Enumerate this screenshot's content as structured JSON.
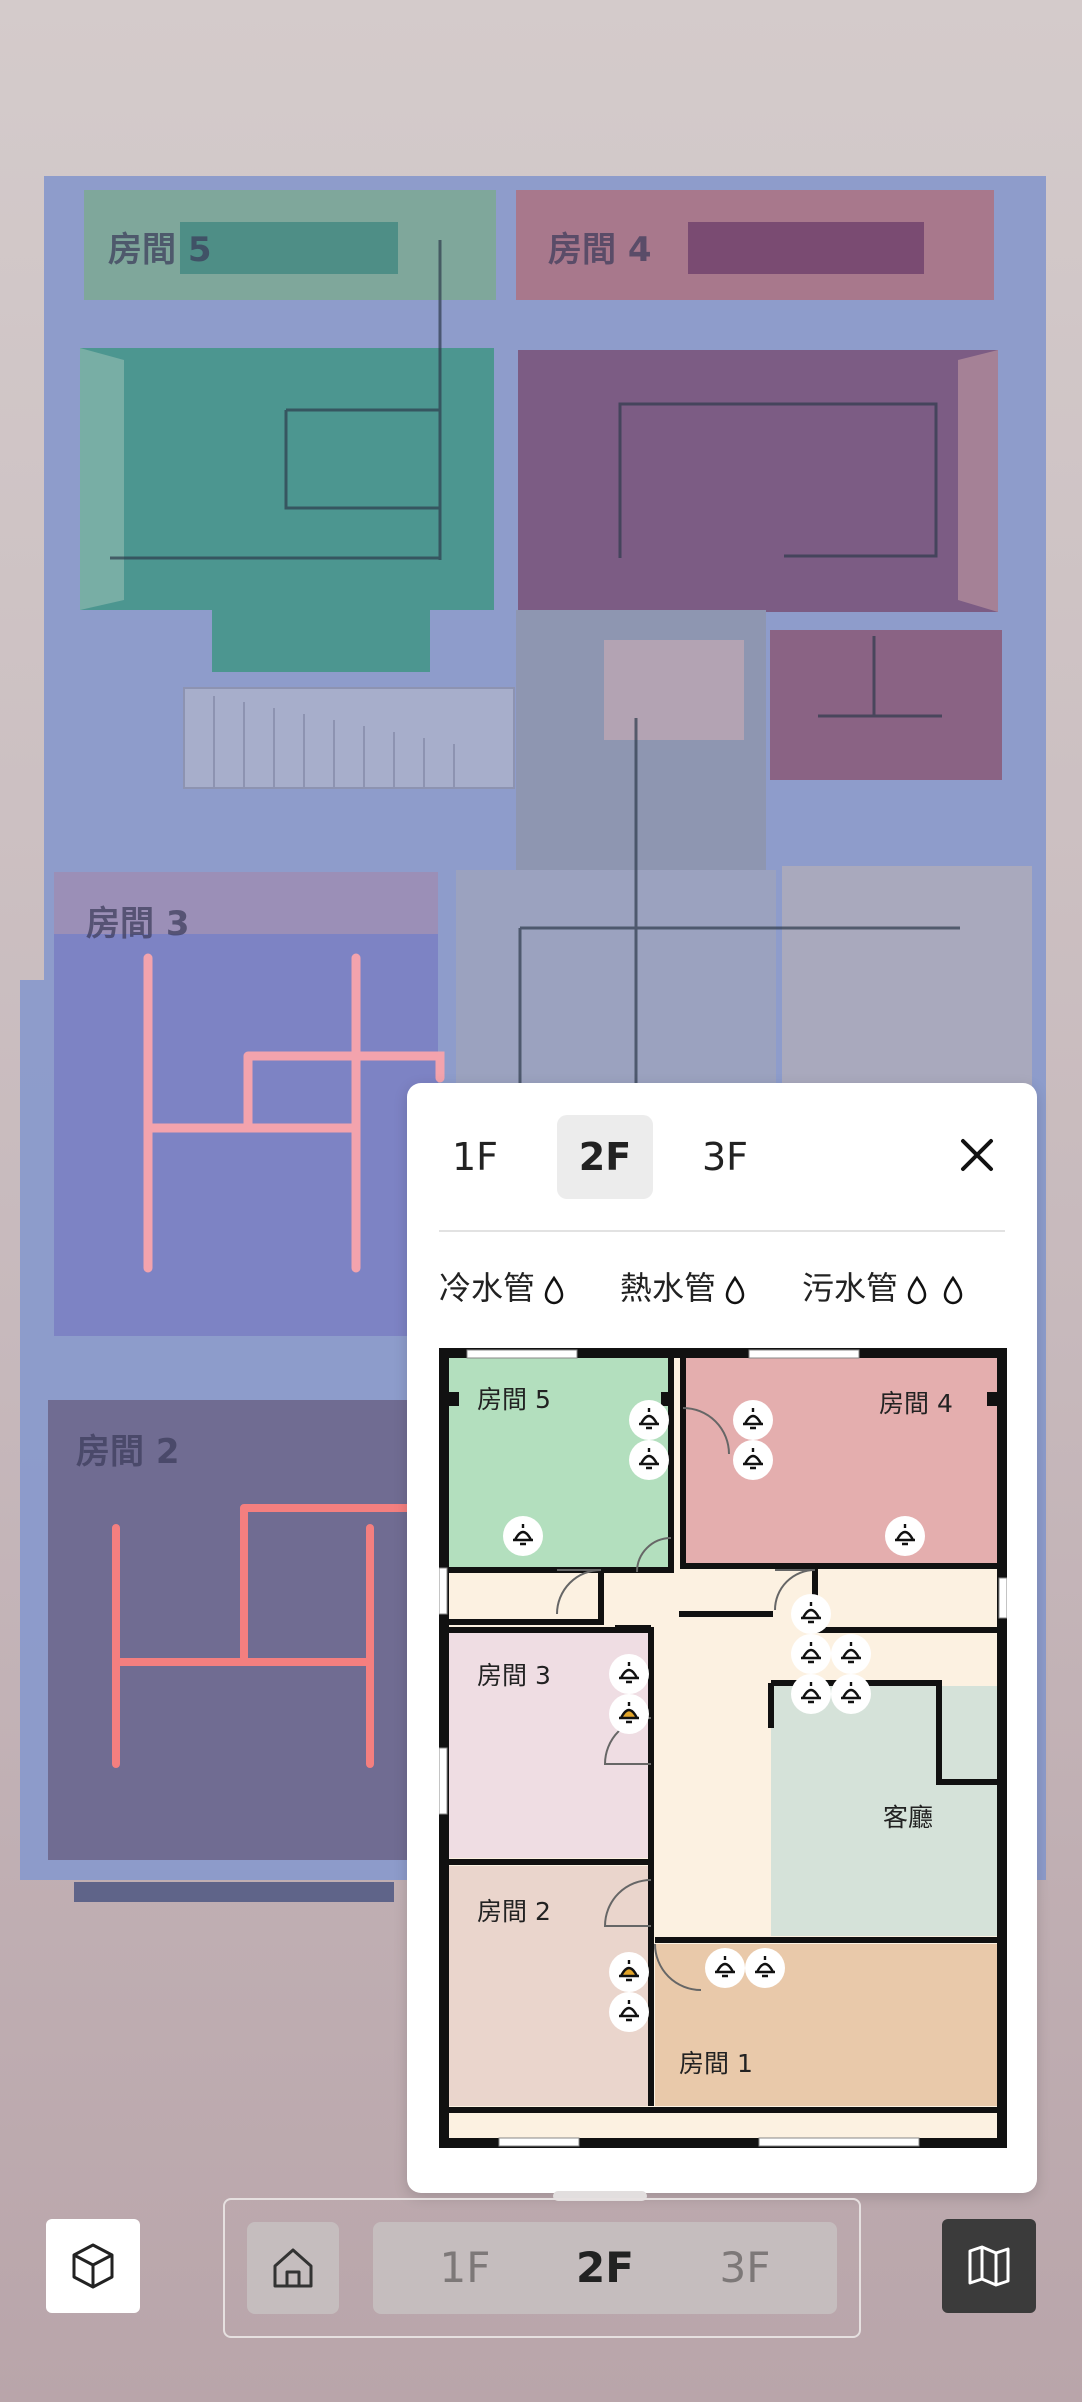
{
  "model_view": {
    "room_labels": [
      "房間 5",
      "房間 4",
      "房間 3",
      "房間 2"
    ]
  },
  "floor_panel": {
    "floors": [
      "1F",
      "2F",
      "3F"
    ],
    "selected_floor": "2F",
    "close_icon": "close-icon",
    "legend": [
      {
        "label": "冷水管",
        "icon": "water-drop-icon"
      },
      {
        "label": "熱水管",
        "icon": "water-drop-icon"
      },
      {
        "label": "污水管",
        "icon": "water-drop-icon"
      }
    ],
    "plan_rooms": [
      "房間 5",
      "房間 4",
      "房間 3",
      "客廳",
      "房間 2",
      "房間 1"
    ],
    "colors": {
      "room5": "#b3dfbe",
      "room4": "#e4aeae",
      "room3": "#efdde3",
      "living": "#d5e2d9",
      "room2": "#ead5cc",
      "room1": "#e9c9aa",
      "hall": "#fcf1e1",
      "lamp_active": "#e2a52a"
    }
  },
  "bottom_bar": {
    "view_3d_icon": "cube-icon",
    "home_icon": "home-icon",
    "floors": [
      "1F",
      "2F",
      "3F"
    ],
    "selected_floor": "2F",
    "map_icon": "map-icon"
  }
}
